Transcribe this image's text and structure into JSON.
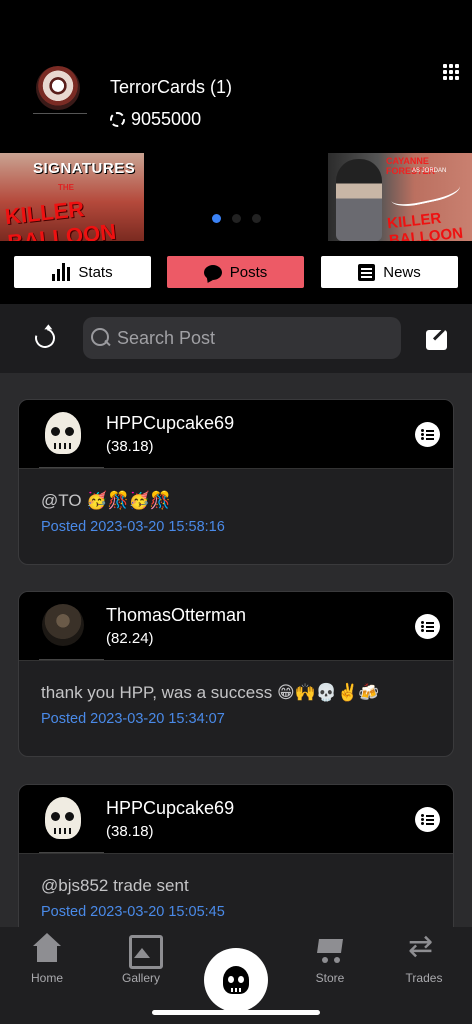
{
  "profile": {
    "name": "TerrorCards (1)",
    "coins": "9055000"
  },
  "carousel": {
    "left": {
      "line1": "SIGNATURES",
      "line2": "THE",
      "line3": "KILLER BALLOON"
    },
    "right": {
      "line1": "CAYANNE FORESTER",
      "line2": "AS JORDAN",
      "line3": "KILLER BALLOON"
    }
  },
  "tabs": {
    "stats": "Stats",
    "posts": "Posts",
    "news": "News"
  },
  "search": {
    "placeholder": "Search Post",
    "value": ""
  },
  "posts": [
    {
      "user": "HPPCupcake69",
      "score": "(38.18)",
      "message": "@TO",
      "emoji": "🥳🎊🥳🎊",
      "posted": "Posted 2023-03-20 15:58:16"
    },
    {
      "user": "ThomasOtterman",
      "score": "(82.24)",
      "message": "thank you HPP, was a success",
      "emoji": "😁🙌💀✌️🍻",
      "posted": "Posted 2023-03-20 15:34:07"
    },
    {
      "user": "HPPCupcake69",
      "score": "(38.18)",
      "message": "@bjs852 trade sent",
      "emoji": "",
      "posted": "Posted 2023-03-20 15:05:45"
    }
  ],
  "nav": {
    "home": "Home",
    "gallery": "Gallery",
    "store": "Store",
    "trades": "Trades"
  },
  "colors": {
    "accent": "#ed5a66",
    "link": "#4a8ae8",
    "dot_active": "#3b82f6"
  }
}
